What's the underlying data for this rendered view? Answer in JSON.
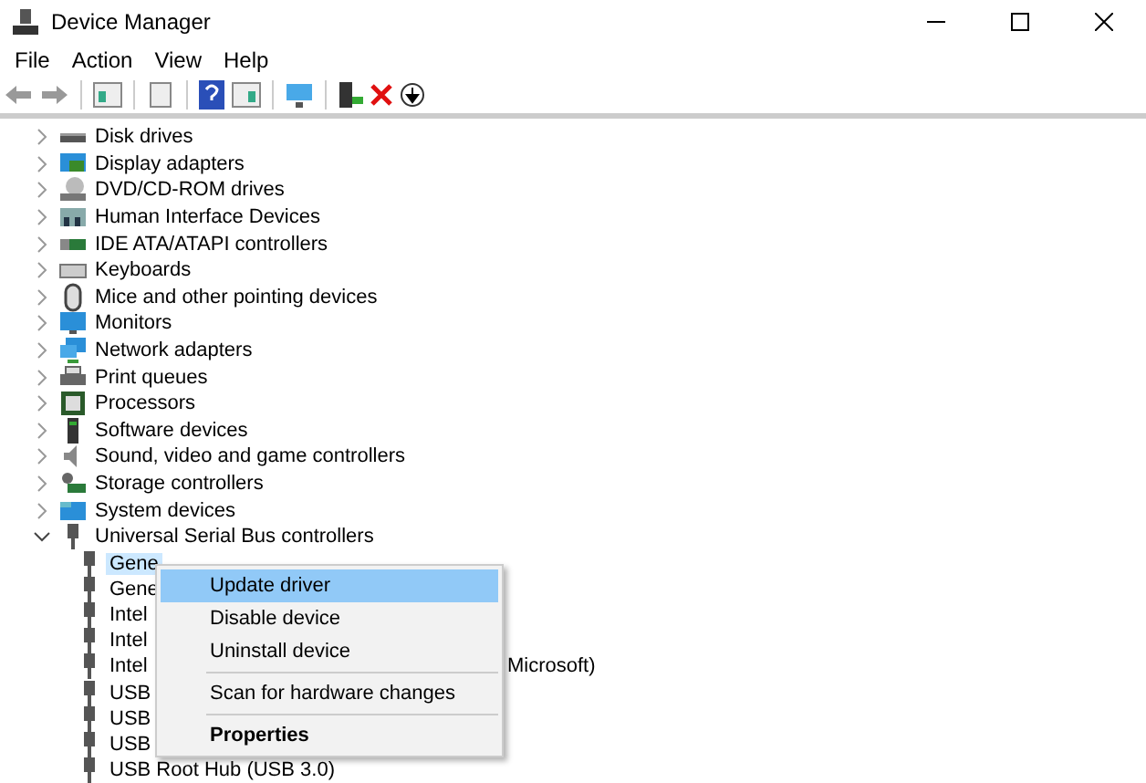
{
  "window": {
    "title": "Device Manager"
  },
  "menu_bar": [
    "File",
    "Action",
    "View",
    "Help"
  ],
  "tree": {
    "items": [
      {
        "label": "Disk drives",
        "expanded": false
      },
      {
        "label": "Display adapters",
        "expanded": false
      },
      {
        "label": "DVD/CD-ROM drives",
        "expanded": false
      },
      {
        "label": "Human Interface Devices",
        "expanded": false
      },
      {
        "label": "IDE ATA/ATAPI controllers",
        "expanded": false
      },
      {
        "label": "Keyboards",
        "expanded": false
      },
      {
        "label": "Mice and other pointing devices",
        "expanded": false
      },
      {
        "label": "Monitors",
        "expanded": false
      },
      {
        "label": "Network adapters",
        "expanded": false
      },
      {
        "label": "Print queues",
        "expanded": false
      },
      {
        "label": "Processors",
        "expanded": false
      },
      {
        "label": "Software devices",
        "expanded": false
      },
      {
        "label": "Sound, video and game controllers",
        "expanded": false
      },
      {
        "label": "Storage controllers",
        "expanded": false
      },
      {
        "label": "System devices",
        "expanded": false
      },
      {
        "label": "Universal Serial Bus controllers",
        "expanded": true,
        "children": [
          {
            "label": "Gene",
            "selected": true
          },
          {
            "label": "Gene",
            "selected": false
          },
          {
            "label": "Intel",
            "selected": false
          },
          {
            "label": "Intel",
            "selected": false
          },
          {
            "label": "Intel",
            "label_tail": "Microsoft)",
            "selected": false
          },
          {
            "label": "USB",
            "selected": false
          },
          {
            "label": "USB",
            "selected": false
          },
          {
            "label": "USB",
            "selected": false
          },
          {
            "label": "USB Root Hub (USB 3.0)",
            "selected": false
          }
        ]
      }
    ]
  },
  "context_menu": [
    {
      "label": "Update driver",
      "selected": true,
      "separator_before": false,
      "default": false
    },
    {
      "label": "Disable device",
      "selected": false,
      "separator_before": false,
      "default": false
    },
    {
      "label": "Uninstall device",
      "selected": false,
      "separator_before": false,
      "default": false
    },
    {
      "label": "Scan for hardware changes",
      "selected": false,
      "separator_before": true,
      "default": false
    },
    {
      "label": "Properties",
      "selected": false,
      "separator_before": true,
      "default": true
    }
  ]
}
